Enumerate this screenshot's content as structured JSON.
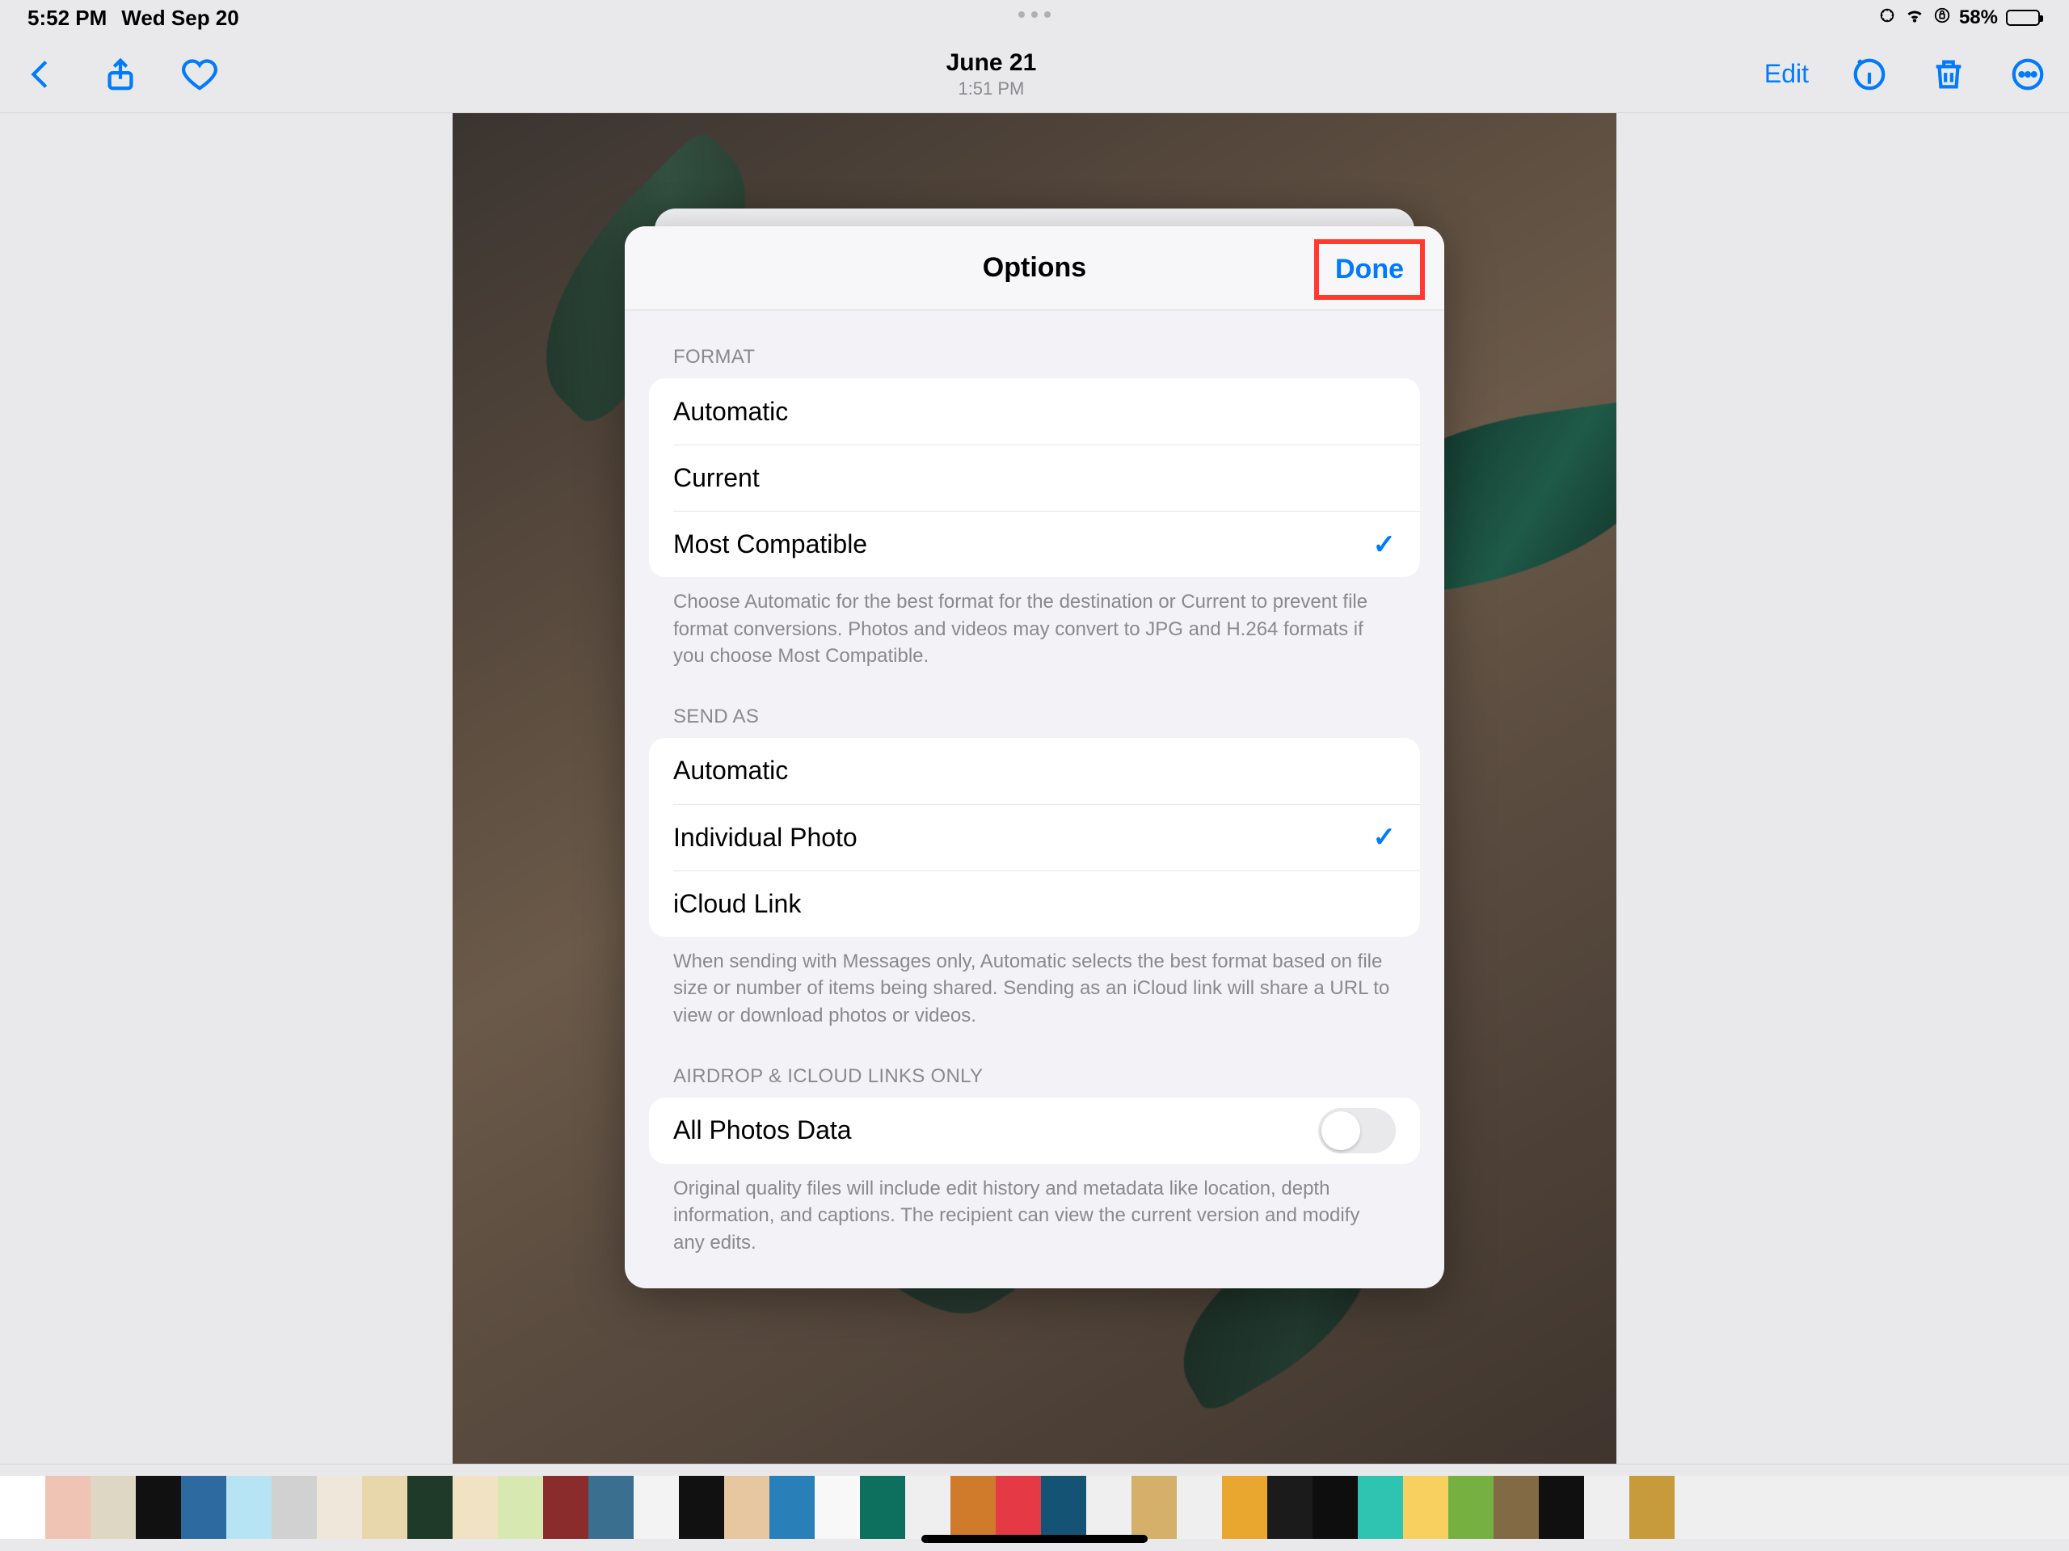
{
  "status_bar": {
    "time": "5:52 PM",
    "date": "Wed Sep 20",
    "battery_pct": "58%",
    "battery_fill_pct": 58
  },
  "nav": {
    "date": "June 21",
    "time": "1:51 PM",
    "edit": "Edit"
  },
  "modal": {
    "title": "Options",
    "done": "Done",
    "format": {
      "label": "FORMAT",
      "rows": {
        "automatic": "Automatic",
        "current": "Current",
        "most_compatible": "Most Compatible"
      },
      "note": "Choose Automatic for the best format for the destination or Current to prevent file format conversions. Photos and videos may convert to JPG and H.264 formats if you choose Most Compatible."
    },
    "send_as": {
      "label": "SEND AS",
      "rows": {
        "automatic": "Automatic",
        "individual_photo": "Individual Photo",
        "icloud_link": "iCloud Link"
      },
      "note": "When sending with Messages only, Automatic selects the best format based on file size or number of items being shared. Sending as an iCloud link will share a URL to view or download photos or videos."
    },
    "airdrop": {
      "label": "AIRDROP & ICLOUD LINKS ONLY",
      "row": "All Photos Data",
      "on": false,
      "note": "Original quality files will include edit history and metadata like location, depth information, and captions. The recipient can view the current version and modify any edits."
    }
  },
  "thumbnail_count": 46
}
